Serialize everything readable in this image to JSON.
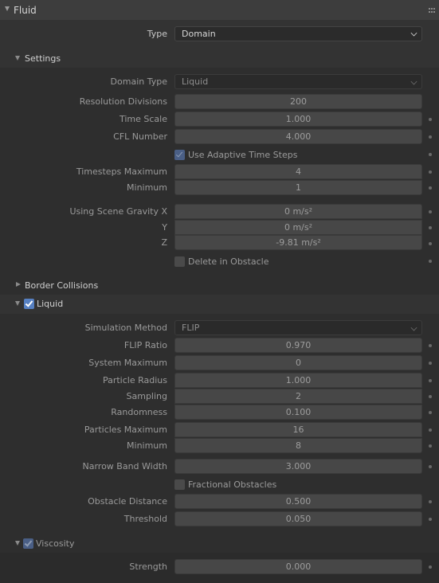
{
  "panel": {
    "title": "Fluid",
    "type_label": "Type",
    "type_value": "Domain"
  },
  "settings": {
    "title": "Settings",
    "domain_type_label": "Domain Type",
    "domain_type_value": "Liquid",
    "resolution_label": "Resolution Divisions",
    "resolution_value": "200",
    "time_scale_label": "Time Scale",
    "time_scale_value": "1.000",
    "cfl_label": "CFL Number",
    "cfl_value": "4.000",
    "adaptive_label": "Use Adaptive Time Steps",
    "adaptive_checked": true,
    "timesteps_max_label": "Timesteps Maximum",
    "timesteps_max_value": "4",
    "timesteps_min_label": "Minimum",
    "timesteps_min_value": "1",
    "gravity_x_label": "Using Scene Gravity X",
    "gravity_x_value": "0 m/s²",
    "gravity_y_label": "Y",
    "gravity_y_value": "0 m/s²",
    "gravity_z_label": "Z",
    "gravity_z_value": "-9.81 m/s²",
    "delete_obstacle_label": "Delete in Obstacle",
    "delete_obstacle_checked": false
  },
  "border_collisions": {
    "title": "Border Collisions",
    "expanded": false
  },
  "liquid": {
    "title": "Liquid",
    "enabled": true,
    "sim_method_label": "Simulation Method",
    "sim_method_value": "FLIP",
    "flip_ratio_label": "FLIP Ratio",
    "flip_ratio_value": "0.970",
    "system_max_label": "System Maximum",
    "system_max_value": "0",
    "particle_radius_label": "Particle Radius",
    "particle_radius_value": "1.000",
    "sampling_label": "Sampling",
    "sampling_value": "2",
    "randomness_label": "Randomness",
    "randomness_value": "0.100",
    "particles_max_label": "Particles Maximum",
    "particles_max_value": "16",
    "particles_min_label": "Minimum",
    "particles_min_value": "8",
    "narrow_band_label": "Narrow Band Width",
    "narrow_band_value": "3.000",
    "fractional_label": "Fractional Obstacles",
    "fractional_checked": false,
    "obstacle_distance_label": "Obstacle Distance",
    "obstacle_distance_value": "0.500",
    "threshold_label": "Threshold",
    "threshold_value": "0.050"
  },
  "viscosity": {
    "title": "Viscosity",
    "enabled": true,
    "strength_label": "Strength",
    "strength_value": "0.000"
  }
}
